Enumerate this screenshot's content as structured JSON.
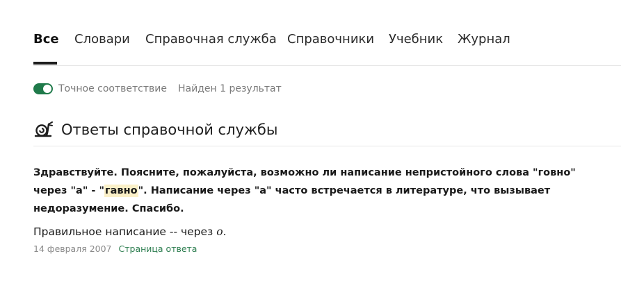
{
  "tabs": [
    {
      "label": "Все",
      "active": true
    },
    {
      "label": "Словари",
      "active": false
    },
    {
      "label": "Справочная служба",
      "active": false
    },
    {
      "label": "Справочники",
      "active": false
    },
    {
      "label": "Учебник",
      "active": false
    },
    {
      "label": "Журнал",
      "active": false
    }
  ],
  "filter": {
    "toggle_label": "Точное соответствие",
    "toggle_on": true,
    "results": "Найден 1 результат"
  },
  "section": {
    "icon": "snail-icon",
    "title": "Ответы справочной службы"
  },
  "question": {
    "text_before": "Здравствуйте. Поясните, пожалуйста, возможно ли написание непристойного слова \"говно\" через \"а\" - \"",
    "highlight": "гавно",
    "text_after": "\". Написание через \"а\" часто встречается в литературе, что вызывает недоразумение. Спасибо."
  },
  "answer": {
    "prefix": "Правильное написание -- через ",
    "letter": "о",
    "suffix": "."
  },
  "meta": {
    "date": "14 февраля 2007",
    "link": "Страница ответа"
  },
  "colors": {
    "accent_green": "#1f7a4a",
    "link_green": "#2c7d4f",
    "highlight": "#fbf0c8"
  }
}
